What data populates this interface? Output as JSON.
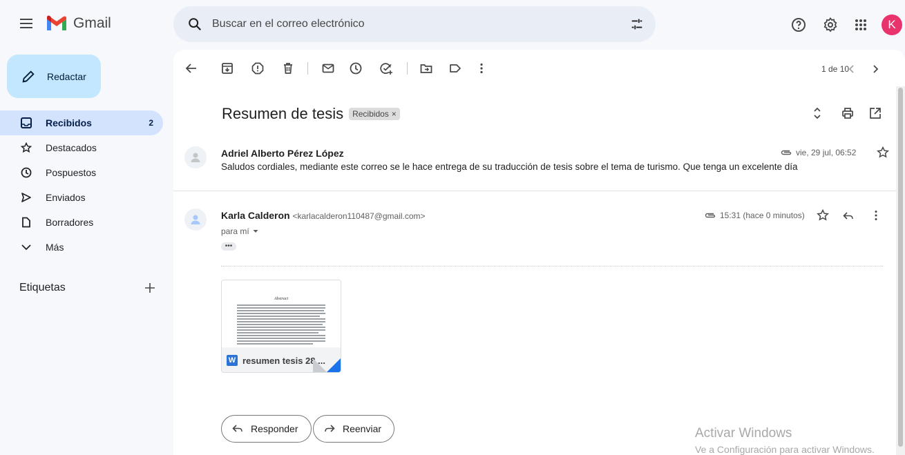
{
  "app": {
    "name": "Gmail"
  },
  "search": {
    "placeholder": "Buscar en el correo electrónico"
  },
  "avatar": {
    "letter": "K",
    "color": "#e8336d"
  },
  "compose": {
    "label": "Redactar"
  },
  "sidebar": {
    "items": [
      {
        "label": "Recibidos",
        "count": "2",
        "icon": "inbox-icon",
        "active": true
      },
      {
        "label": "Destacados",
        "icon": "star-icon"
      },
      {
        "label": "Pospuestos",
        "icon": "clock-icon"
      },
      {
        "label": "Enviados",
        "icon": "send-icon"
      },
      {
        "label": "Borradores",
        "icon": "draft-icon"
      },
      {
        "label": "Más",
        "icon": "chevron-down-icon"
      }
    ],
    "labels_title": "Etiquetas"
  },
  "toolbar": {
    "pager": "1 de 10"
  },
  "thread": {
    "subject": "Resumen de tesis",
    "label_chip": "Recibidos",
    "label_chip_close": "×",
    "messages": [
      {
        "sender": "Adriel Alberto Pérez López",
        "snippet": "Saludos cordiales, mediante este correo se le hace entrega de su traducción de tesis sobre el tema de turismo. Que tenga un excelente día",
        "date": "vie, 29 jul, 06:52",
        "has_attachment": true
      },
      {
        "sender": "Karla Calderon",
        "email": "<karlacalderon110487@gmail.com>",
        "to": "para mí",
        "date": "15:31 (hace 0 minutos)",
        "ellipsis": "•••",
        "attachment": {
          "preview_title": "Abstract",
          "name": "resumen tesis 28....",
          "type_letter": "W"
        }
      }
    ]
  },
  "actions": {
    "reply": "Responder",
    "forward": "Reenviar"
  },
  "watermark": {
    "title": "Activar Windows",
    "subtitle": "Ve a Configuración para activar Windows."
  },
  "colors": {
    "accent": "#0b57d0",
    "compose_bg": "#c2e7ff",
    "active_nav": "#d3e3fd",
    "word": "#2b73d7"
  }
}
